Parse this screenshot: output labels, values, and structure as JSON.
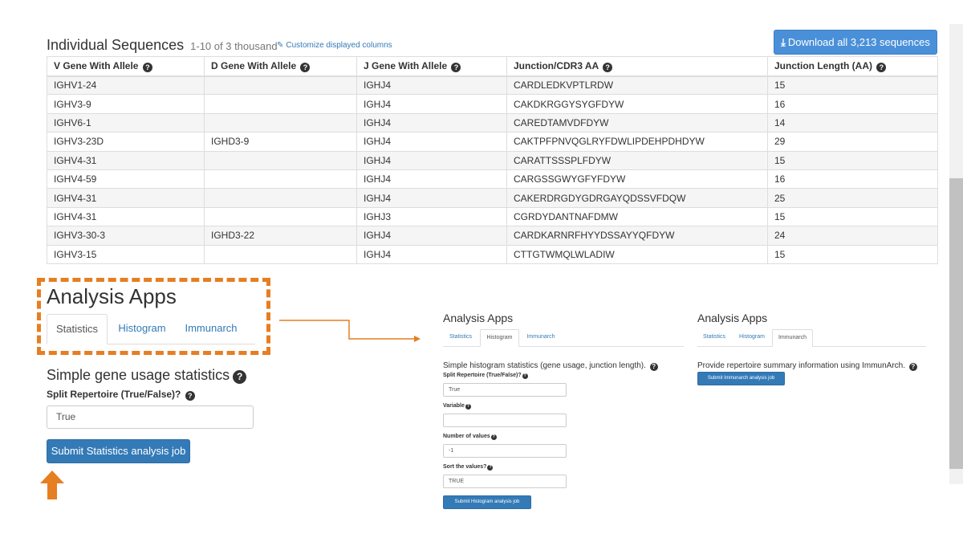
{
  "sequences": {
    "title": "Individual Sequences",
    "subtitle": "1-10 of 3 thousand",
    "customize_label": "Customize displayed columns",
    "download_label": "Download all 3,213 sequences",
    "columns": [
      "V Gene With Allele",
      "D Gene With Allele",
      "J Gene With Allele",
      "Junction/CDR3 AA",
      "Junction Length (AA)"
    ],
    "rows": [
      [
        "IGHV1-24",
        "",
        "IGHJ4",
        "CARDLEDKVPTLRDW",
        "15"
      ],
      [
        "IGHV3-9",
        "",
        "IGHJ4",
        "CAKDKRGGYSYGFDYW",
        "16"
      ],
      [
        "IGHV6-1",
        "",
        "IGHJ4",
        "CAREDTAMVDFDYW",
        "14"
      ],
      [
        "IGHV3-23D",
        "IGHD3-9",
        "IGHJ4",
        "CAKTPFPNVQGLRYFDWLIPDEHPDHDYW",
        "29"
      ],
      [
        "IGHV4-31",
        "",
        "IGHJ4",
        "CARATTSSSPLFDYW",
        "15"
      ],
      [
        "IGHV4-59",
        "",
        "IGHJ4",
        "CARGSSGWYGFYFDYW",
        "16"
      ],
      [
        "IGHV4-31",
        "",
        "IGHJ4",
        "CAKERDRGDYGDRGAYQDSSVFDQW",
        "25"
      ],
      [
        "IGHV4-31",
        "",
        "IGHJ3",
        "CGRDYDANTNAFDMW",
        "15"
      ],
      [
        "IGHV3-30-3",
        "IGHD3-22",
        "IGHJ4",
        "CARDKARNRFHYYDSSAYYQFDYW",
        "24"
      ],
      [
        "IGHV3-15",
        "",
        "IGHJ4",
        "CTTGTWMQLWLADIW",
        "15"
      ]
    ]
  },
  "analysis": {
    "title": "Analysis Apps",
    "tabs": [
      "Statistics",
      "Histogram",
      "Immunarch"
    ],
    "statistics": {
      "heading": "Simple gene usage statistics",
      "split_label": "Split Repertoire (True/False)?",
      "split_value": "True",
      "submit_label": "Submit Statistics analysis job"
    },
    "histogram": {
      "heading": "Simple histogram statistics (gene usage, junction length).",
      "split_label": "Split Repertoire (True/False)?",
      "split_value": "True",
      "variable_label": "Variable",
      "variable_value": "",
      "num_values_label": "Number of values",
      "num_values_value": "-1",
      "sort_label": "Sort the values?",
      "sort_value": "TRUE",
      "submit_label": "Submit Histogram analysis job"
    },
    "immunarch": {
      "heading": "Provide repertoire summary information using ImmunArch.",
      "submit_label": "Submit Immunarch analysis job"
    }
  },
  "colors": {
    "accent": "#337ab7",
    "annotation": "#e67e22",
    "download_button": "#4a90d9"
  },
  "icons": [
    "question-circle-icon",
    "edit-icon",
    "download-icon",
    "up-arrow-icon",
    "connector-arrow-icon"
  ]
}
